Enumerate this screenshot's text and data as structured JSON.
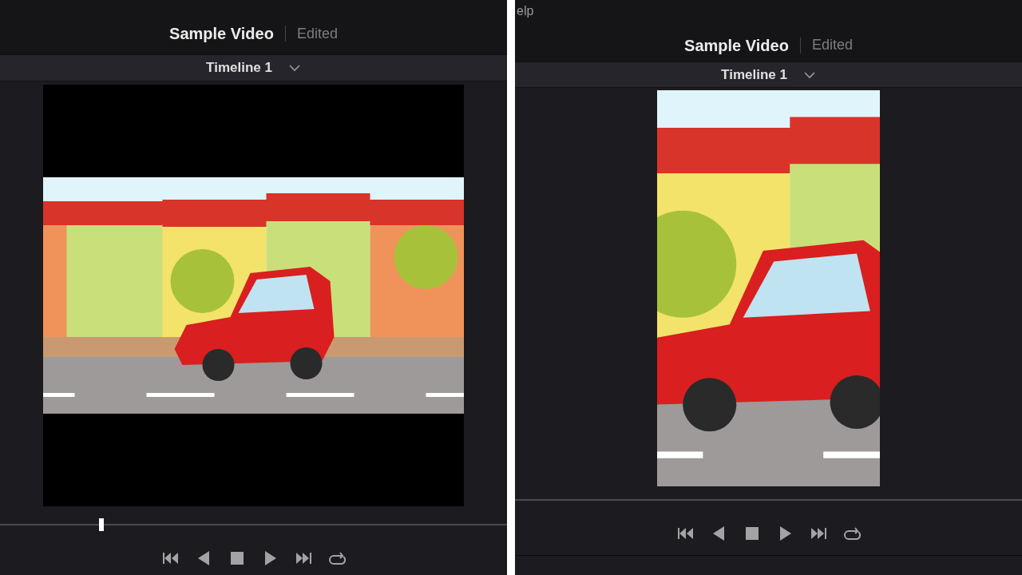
{
  "viewers": [
    {
      "title": "Sample Video",
      "status": "Edited",
      "timeline": "Timeline 1",
      "kind": "letterbox",
      "playhead": {
        "level": 0.2
      }
    },
    {
      "menu_fragment": "elp",
      "title": "Sample Video",
      "status": "Edited",
      "timeline": "Timeline 1",
      "kind": "portrait"
    }
  ]
}
